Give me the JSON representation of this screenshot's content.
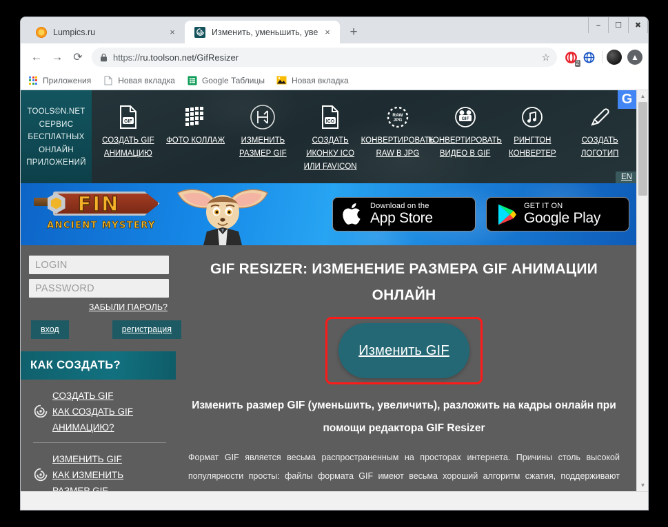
{
  "browser": {
    "tabs": [
      {
        "title": "Lumpics.ru",
        "favicon": "orange-slice-icon",
        "active": false,
        "close_label": "×"
      },
      {
        "title": "Изменить, уменьшить, увеличит",
        "favicon": "toolson-spiral-icon",
        "active": true,
        "close_label": "×"
      }
    ],
    "new_tab_label": "+",
    "window_controls": {
      "minimize": "minimize-icon",
      "maximize": "maximize-icon",
      "close": "close-icon"
    },
    "nav": {
      "back": "←",
      "forward": "→",
      "reload": "⟳"
    },
    "omnibox": {
      "scheme": "https://",
      "host_path": "ru.toolson.net/GifResizer",
      "full_url": "https://ru.toolson.net/GifResizer",
      "lock_icon": "lock-icon",
      "star_icon": "☆"
    },
    "extensions": {
      "opera_badge_count": "2"
    },
    "bookmarks": [
      {
        "label": "Приложения",
        "icon": "apps-grid-icon"
      },
      {
        "label": "Новая вкладка",
        "icon": "page-icon"
      },
      {
        "label": "Google Таблицы",
        "icon": "sheets-icon"
      },
      {
        "label": "Новая вкладка",
        "icon": "image-icon"
      }
    ]
  },
  "site": {
    "brand": {
      "line1": "TOOLS©N.NET",
      "line2": "СЕРВИС",
      "line3": "БЕСПЛАТНЫХ",
      "line4": "ОНЛАЙН",
      "line5": "ПРИЛОЖЕНИЙ"
    },
    "g_badge": "G",
    "lang_switch": "EN",
    "nav": [
      {
        "icon": "gif-file-icon",
        "line1": "СОЗДАТЬ GIF",
        "line2": "АНИМАЦИЮ",
        "line3": ""
      },
      {
        "icon": "collage-icon",
        "line1": "ФОТО КОЛЛАЖ",
        "line2": "",
        "line3": ""
      },
      {
        "icon": "resize-icon",
        "line1": "ИЗМЕНИТЬ",
        "line2": "РАЗМЕР GIF",
        "line3": ""
      },
      {
        "icon": "ico-file-icon",
        "line1": "СОЗДАТЬ",
        "line2": "ИКОНКУ ICO",
        "line3": "ИЛИ FAVICON"
      },
      {
        "icon": "raw-jpg-icon",
        "line1": "КОНВЕРТИРОВАТЬ",
        "line2": "RAW В JPG",
        "line3": ""
      },
      {
        "icon": "video-gif-icon",
        "line1": "КОНВЕРТИРОВАТЬ",
        "line2": "ВИДЕО В GIF",
        "line3": ""
      },
      {
        "icon": "music-note-icon",
        "line1": "РИНГТОН",
        "line2": "КОНВЕРТЕР",
        "line3": ""
      },
      {
        "icon": "pencil-icon",
        "line1": "СОЗДАТЬ",
        "line2": "ЛОГОТИП",
        "line3": ""
      }
    ],
    "banner": {
      "game_title": "FIN",
      "game_subtitle": "ANCIENT MYSTERY",
      "appstore_small": "Download on the",
      "appstore_big": "App Store",
      "googleplay_small": "GET IT ON",
      "googleplay_big": "Google Play"
    },
    "sidebar": {
      "login_placeholder": "LOGIN",
      "password_placeholder": "PASSWORD",
      "forgot_password": "ЗАБЫЛИ ПАРОЛЬ?",
      "login_button": "вход",
      "register_button": "регистрация",
      "howto_header": "КАК СОЗДАТЬ?",
      "howto_items": [
        {
          "icon": "spiral-icon",
          "links": [
            "СОЗДАТЬ GIF",
            "КАК СОЗДАТЬ GIF",
            "АНИМАЦИЮ?"
          ]
        },
        {
          "icon": "spiral-icon",
          "links": [
            "ИЗМЕНИТЬ GIF",
            "КАК ИЗМЕНИТЬ",
            "РАЗМЕР GIF"
          ]
        }
      ]
    },
    "main": {
      "title": "GIF RESIZER: ИЗМЕНЕНИЕ РАЗМЕРА GIF АНИМАЦИИ ОНЛАЙН",
      "cta_label": "Изменить GIF",
      "subtitle": "Изменить размер GIF (уменьшить, увеличить), разложить на кадры онлайн при помощи редактора GIF Resizer",
      "body": "Формат GIF является весьма распространенным на просторах интернета. Причины столь высокой популярности просты: файлы формата GIF имеют весьма хороший алгоритм сжатия, поддерживают прозрачность и дают возможность создать как простую, так и сложную анимацию и рекламные"
    }
  },
  "colors": {
    "brand_teal": "#11606b",
    "cta_teal": "#236874",
    "highlight_red": "#ff1a1a",
    "page_bg": "#5d5d5d",
    "header_dark": "#233136",
    "google_blue": "#4285f4"
  }
}
